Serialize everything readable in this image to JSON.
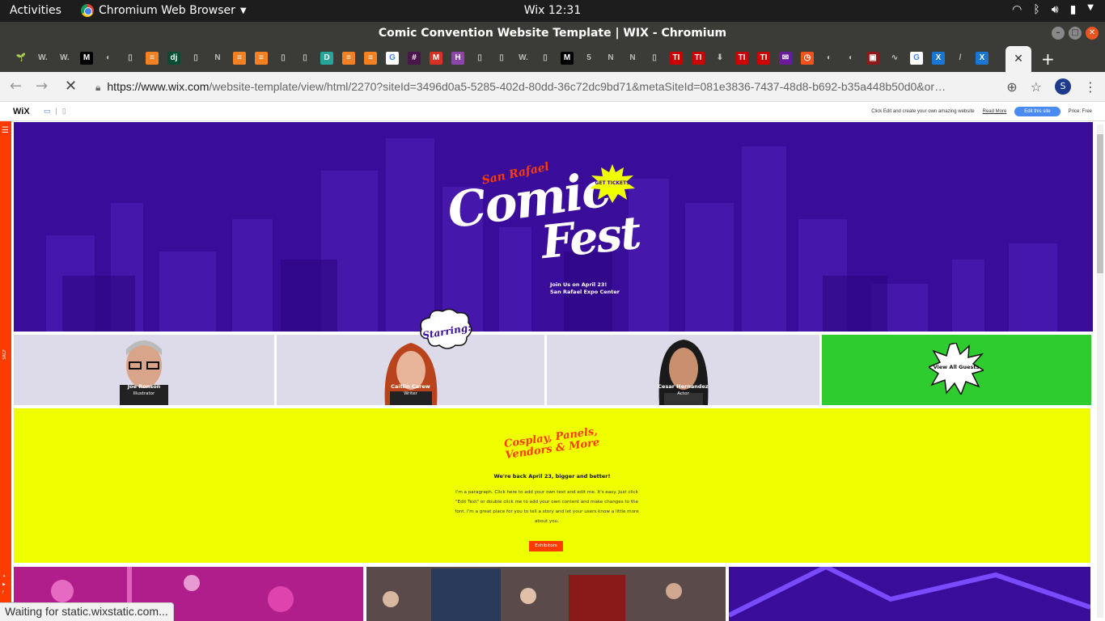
{
  "system": {
    "activities": "Activities",
    "app_name": "Chromium Web Browser",
    "clock": "Wix 12:31"
  },
  "window": {
    "title": "Comic Convention Website Template | WIX - Chromium"
  },
  "tabs": [
    {
      "icon": "sprout-icon",
      "text": "🌱",
      "color": "#3b3b37"
    },
    {
      "icon": "w-icon",
      "text": "W.",
      "color": "#3b3b37"
    },
    {
      "icon": "w-icon",
      "text": "W.",
      "color": "#3b3b37"
    },
    {
      "icon": "medium-icon",
      "text": "M",
      "color": "#000000"
    },
    {
      "icon": "github-icon",
      "text": "◐",
      "color": "#3b3b37"
    },
    {
      "icon": "page-icon",
      "text": "▯",
      "color": "#3b3b37"
    },
    {
      "icon": "stackoverflow-icon",
      "text": "≡",
      "color": "#f48024"
    },
    {
      "icon": "django-icon",
      "text": "dj",
      "color": "#0c4b33"
    },
    {
      "icon": "page-icon",
      "text": "▯",
      "color": "#3b3b37"
    },
    {
      "icon": "notion-icon",
      "text": "N",
      "color": "#3b3b37"
    },
    {
      "icon": "stackoverflow-icon",
      "text": "≡",
      "color": "#f48024"
    },
    {
      "icon": "stackoverflow-icon",
      "text": "≡",
      "color": "#f48024"
    },
    {
      "icon": "page-icon",
      "text": "▯",
      "color": "#3b3b37"
    },
    {
      "icon": "page-icon",
      "text": "▯",
      "color": "#3b3b37"
    },
    {
      "icon": "d-icon",
      "text": "D",
      "color": "#26a69a"
    },
    {
      "icon": "stackoverflow-icon",
      "text": "≡",
      "color": "#f48024"
    },
    {
      "icon": "stackoverflow-icon",
      "text": "≡",
      "color": "#f48024"
    },
    {
      "icon": "google-icon",
      "text": "G",
      "color": "#ffffff"
    },
    {
      "icon": "slack-icon",
      "text": "#",
      "color": "#4a154b"
    },
    {
      "icon": "gmail-icon",
      "text": "M",
      "color": "#d93025"
    },
    {
      "icon": "h-icon",
      "text": "H",
      "color": "#8e44ad"
    },
    {
      "icon": "page-icon",
      "text": "▯",
      "color": "#3b3b37"
    },
    {
      "icon": "page-icon",
      "text": "▯",
      "color": "#3b3b37"
    },
    {
      "icon": "w-icon",
      "text": "W.",
      "color": "#3b3b37"
    },
    {
      "icon": "page-icon",
      "text": "▯",
      "color": "#3b3b37"
    },
    {
      "icon": "medium-icon",
      "text": "M",
      "color": "#000000"
    },
    {
      "icon": "five-icon",
      "text": "5",
      "color": "#3b3b37"
    },
    {
      "icon": "notion-icon",
      "text": "N",
      "color": "#3b3b37"
    },
    {
      "icon": "notion-icon",
      "text": "N",
      "color": "#3b3b37"
    },
    {
      "icon": "page-icon",
      "text": "▯",
      "color": "#3b3b37"
    },
    {
      "icon": "ti-icon",
      "text": "TI",
      "color": "#cc0000"
    },
    {
      "icon": "ti-icon",
      "text": "TI",
      "color": "#cc0000"
    },
    {
      "icon": "download-icon",
      "text": "⬇",
      "color": "#3b3b37"
    },
    {
      "icon": "ti-icon",
      "text": "TI",
      "color": "#cc0000"
    },
    {
      "icon": "ti-icon",
      "text": "TI",
      "color": "#cc0000"
    },
    {
      "icon": "mail-icon",
      "text": "✉",
      "color": "#6a1b9a"
    },
    {
      "icon": "clock-icon",
      "text": "◷",
      "color": "#f4511e"
    },
    {
      "icon": "github-icon",
      "text": "◐",
      "color": "#3b3b37"
    },
    {
      "icon": "github-icon",
      "text": "◐",
      "color": "#3b3b37"
    },
    {
      "icon": "image-icon",
      "text": "▣",
      "color": "#8b1a1a"
    },
    {
      "icon": "m-icon",
      "text": "∿",
      "color": "#3b3b37"
    },
    {
      "icon": "google-icon",
      "text": "G",
      "color": "#ffffff"
    },
    {
      "icon": "x-icon",
      "text": "X",
      "color": "#1976d2"
    },
    {
      "icon": "slash-icon",
      "text": "/",
      "color": "#3b3b37"
    },
    {
      "icon": "x-icon",
      "text": "X",
      "color": "#1976d2"
    }
  ],
  "address_bar": {
    "host": "https://www.wix.com",
    "path": "/website-template/view/html/2270?siteId=3496d0a5-5285-402d-80dd-36c72dc9bd71&metaSiteId=081e3836-7437-48d8-b692-b35a448b50d0&or…"
  },
  "wix_bar": {
    "logo": "WiX",
    "promo": "Click Edit and create your own amazing website",
    "read_more": "Read More",
    "edit_button": "Edit this site",
    "price": "Price: Free"
  },
  "sidebar": {
    "label": "SRCF"
  },
  "hero": {
    "kicker": "San Rafael",
    "title_line1": "Comic",
    "title_line2": "Fest",
    "tickets": "GET TICKETS",
    "sub_line1": "Join Us on April 23!",
    "sub_line2": "San Rafael Expo Center",
    "bg_color": "#3a0c9a"
  },
  "guests": {
    "starring": "Starring:",
    "items": [
      {
        "name": "Joe Ronson",
        "role": "Illustrator"
      },
      {
        "name": "Caitlin Carew",
        "role": "Writer"
      },
      {
        "name": "Cesar Hernandez",
        "role": "Actor"
      }
    ],
    "view_all": "View All Guests"
  },
  "info": {
    "headline": "Cosplay, Panels, Vendors & More",
    "subhead": "We're back April 23, bigger and better!",
    "paragraph": "I'm a paragraph. Click here to add your own text and edit me. It's easy. Just click \"Edit Text\" or double click me to add your own content and make changes to the font. I'm a great place for you to tell a story and let your users know a little more about you.",
    "button": "Exhibitors",
    "bg_color": "#f0ff00",
    "accent": "#ff3c00"
  },
  "status_bar": {
    "text": "Waiting for static.wixstatic.com..."
  }
}
